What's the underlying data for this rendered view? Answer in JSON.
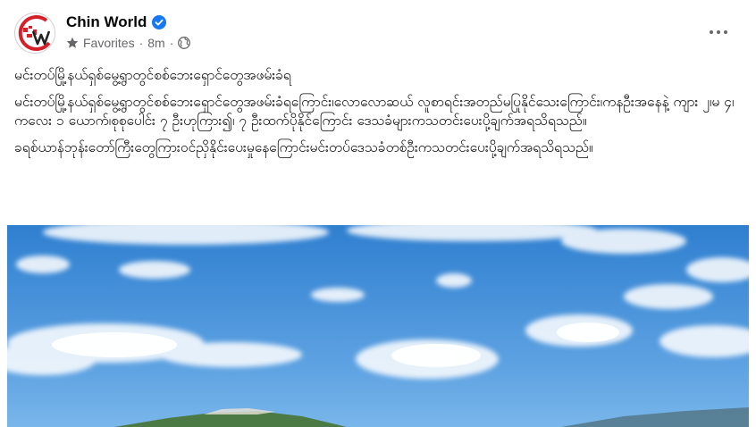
{
  "post": {
    "page_name": "Chin World",
    "verified_icon": "verified-badge-icon",
    "audience": "Favorites",
    "audience_icon": "star-icon",
    "separator": "·",
    "time": "8m",
    "privacy_icon": "globe-icon",
    "avatar_icon": "chin-world-logo-icon",
    "more_icon": "more-options-icon",
    "text": {
      "headline": "မင်းတပ်မြို့နယ်ရှစ်မွေ့ရွာတွင်စစ်ဘေးရှောင်တွေအဖမ်းခံရ",
      "paragraph_1": "မင်းတပ်မြို့နယ်ရှစ်မွေ့ရွာတွင်စစ်ဘေးရှောင်တွေအဖမ်းခံရကြောင်း၊လောလောဆယ် လူစာရင်းအတည်မပြုနိုင်သေးကြောင်း၊ကနဦးအနေနဲ့ ကျား ၂၊မ ၄၊ကလေး ၁ ယောက်၊စုစုပေါင်း ၇ ဦးဟုကြား၍၊ ၇ ဦးထက်ပိုနိုင်ကြောင်း ဒေသခံများကသတင်းပေးပို့ချက်အရသိရသည်။",
      "paragraph_2": "ခရစ်ယာန်ဘုန်းတော်ကြီးတွေကြားဝင်ညှိနိုင်းပေးမှုနေကြောင်းမင်းတပ်ဒေသခံတစ်ဦးကသတင်းပေးပို့ချက်အရသိရသည်။"
    },
    "photo_alt": "Landscape photo: blue sky with white clouds above green hills"
  },
  "colors": {
    "verified_blue": "#1877f2",
    "meta_gray": "#65676b",
    "sky_top": "#2f7fd0",
    "sky_bottom": "#79b6ea",
    "hill": "#3f6b3a",
    "logo_red": "#d5202a"
  }
}
